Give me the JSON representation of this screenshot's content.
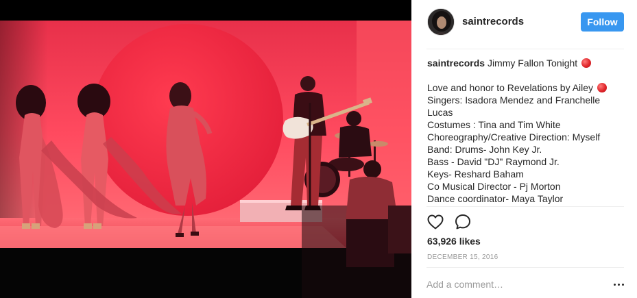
{
  "post": {
    "account": {
      "username": "saintrecords",
      "follow_label": "Follow"
    },
    "caption": {
      "author": "saintrecords",
      "headline": "Jimmy Fallon Tonight",
      "lines": [
        "Love and honor to Revelations by Ailey",
        "Singers: Isadora Mendez and Franchelle Lucas",
        "Costumes : Tina and Tim White",
        "Choreography/Creative Direction: Myself",
        "Band: Drums- John Key Jr.",
        "Bass - David \"DJ\" Raymond Jr.",
        "Keys- Reshard Baham",
        "Co Musical Director - Pj Morton",
        "Dance coordinator- Maya Taylor"
      ]
    },
    "likes_text": "63,926 likes",
    "date_text": "DECEMBER 15, 2016",
    "comment_placeholder": "Add a comment…"
  },
  "icons": {
    "heart": "heart-outline-icon",
    "comment": "speech-bubble-icon",
    "more": "ellipsis-icon",
    "caption_emoji": "red-circle-emoji"
  },
  "colors": {
    "follow_button": "#3897f0",
    "stage_red": "#e8344a",
    "backdrop_pink": "#ff4d63"
  }
}
